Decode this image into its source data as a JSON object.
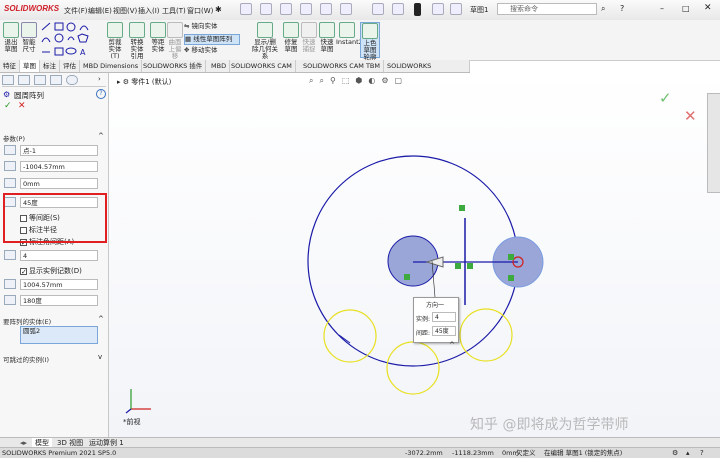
{
  "app": {
    "logo": "SOLIDWORKS",
    "document": "草图1",
    "search_placeholder": "搜索命令"
  },
  "menu": [
    "文件(F)",
    "编辑(E)",
    "视图(V)",
    "插入(I)",
    "工具(T)",
    "窗口(W)"
  ],
  "ribbon": {
    "exit_sketch": "退出草图",
    "smart_dimension": "智能尺寸",
    "trim": "剪裁实体(T)",
    "convert": "转换实体引用",
    "offset": "等距实体",
    "surface": "曲面上偏移",
    "mirror": "镜向实体",
    "linear_pattern": "线性草图阵列",
    "move": "移动实体",
    "display_relations": "显示/删除几何关系",
    "repair": "修复草图",
    "rapid_sketch": "快速捕捉",
    "quick_sketch": "快速草图",
    "instant2d": "Instant2D",
    "shaded_contours": "上色草图轮廓"
  },
  "tabs": [
    "特征",
    "草图",
    "标注",
    "评估",
    "MBD Dimensions",
    "SOLIDWORKS 插件",
    "MBD",
    "SOLIDWORKS CAM",
    "SOLIDWORKS CAM TBM",
    "SOLIDWORKS Inspection"
  ],
  "panel": {
    "title": "圆周阵列",
    "params_label": "参数(P)",
    "center_point": "点-1",
    "x_coord": "-1004.57mm",
    "y_coord": "0mm",
    "angle": "45度",
    "equal_spacing": "等间距(S)",
    "dim_radius": "标注半径",
    "dim_angle_spacing": "标注角间距(A)",
    "instances": "4",
    "show_count": "显示实例记数(D)",
    "radius": "1004.57mm",
    "arc_angle": "180度",
    "entities_label": "要阵列的实体(E)",
    "entity_item": "圆弧2",
    "skip_label": "可跳过的实例(I)"
  },
  "canvas": {
    "tree_item": "零件1 (默认)",
    "callout_title": "方向一",
    "callout_instances_label": "实例:",
    "callout_instances_value": "4",
    "callout_spacing_label": "间距:",
    "callout_spacing_value": "45度",
    "view_label": "*前视"
  },
  "bottom_tabs": [
    "模型",
    "3D 视图",
    "运动算例 1"
  ],
  "status": {
    "product": "SOLIDWORKS Premium 2021 SP5.0",
    "x": "-3072.2mm",
    "y": "-1118.23mm",
    "z": "0mm",
    "state": "欠定义",
    "editing": "在编辑 草图1 (锁定的焦点)"
  },
  "watermark": "知乎 @即将成为哲学带师",
  "colors": {
    "sketch": "#1a1aa8",
    "instance": "#e8e020",
    "highlight": "#7a9ce0",
    "accent_red": "#d0202a"
  }
}
